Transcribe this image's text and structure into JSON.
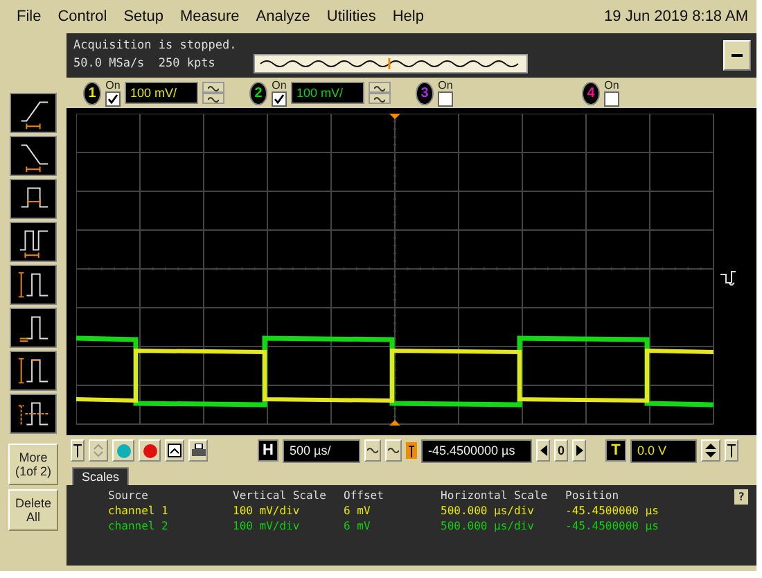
{
  "menu": {
    "items": [
      "File",
      "Control",
      "Setup",
      "Measure",
      "Analyze",
      "Utilities",
      "Help"
    ],
    "datetime": "19 Jun 2019  8:18 AM"
  },
  "status": {
    "message": "Acquisition is stopped.",
    "sample_rate": "50.0 MSa/s",
    "memory": "250 kpts"
  },
  "channels": [
    {
      "number": "1",
      "color": "#e8e800",
      "on_label": "On",
      "on": true,
      "scale": "100 mV/"
    },
    {
      "number": "2",
      "color": "#10d010",
      "on_label": "On",
      "on": true,
      "scale": "100 mV/"
    },
    {
      "number": "3",
      "color": "#a030e0",
      "on_label": "On",
      "on": false
    },
    {
      "number": "4",
      "color": "#f01090",
      "on_label": "On",
      "on": false
    }
  ],
  "sidebar": {
    "buttons": [
      "More\n(1of 2)",
      "Delete\nAll"
    ]
  },
  "controls": {
    "horizontal_label": "H",
    "time_scale": "500 µs/",
    "delay": "-45.4500000 µs",
    "delay_reference": "0",
    "trigger_label": "T",
    "trigger_level": "0.0 V"
  },
  "tabs": [
    {
      "label": "Scales",
      "selected": true
    }
  ],
  "scales": {
    "columns": [
      "Source",
      "Vertical Scale",
      "Offset",
      "Horizontal Scale",
      "Position"
    ],
    "rows": [
      {
        "color": "#e8e800",
        "cells": [
          "channel 1",
          "100 mV/div",
          "6 mV",
          "500.000 µs/div",
          "-45.4500000 µs"
        ]
      },
      {
        "color": "#10d010",
        "cells": [
          "channel 2",
          "100 mV/div",
          "6 mV",
          "500.000 µs/div",
          "-45.4500000 µs"
        ]
      }
    ],
    "help": "?"
  }
}
